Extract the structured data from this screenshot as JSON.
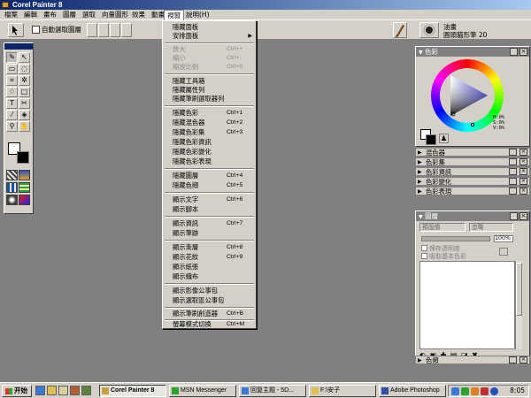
{
  "window": {
    "title": "Corel Painter 8"
  },
  "menubar": {
    "items": [
      {
        "label": "檔案"
      },
      {
        "label": "編輯"
      },
      {
        "label": "畫布"
      },
      {
        "label": "圖層"
      },
      {
        "label": "選取"
      },
      {
        "label": "向量圖形"
      },
      {
        "label": "效果"
      },
      {
        "label": "動畫"
      },
      {
        "label": "視窗"
      },
      {
        "label": "說明(H)"
      }
    ],
    "active_index": 8
  },
  "propbar": {
    "auto_select_layer_label": "自動選取圖層",
    "brush_category": "油畫",
    "brush_variant": "圓頭貓形筆 20"
  },
  "window_menu": {
    "items": [
      {
        "label": "隱藏面板",
        "shortcut": ""
      },
      {
        "label": "安排面板",
        "shortcut": "",
        "submenu": true
      },
      {
        "label": "放大",
        "shortcut": "Ctrl++",
        "disabled": true
      },
      {
        "label": "縮小",
        "shortcut": "Ctrl+-",
        "disabled": true
      },
      {
        "label": "縮放比例",
        "shortcut": "Ctrl+0",
        "disabled": true
      },
      {
        "label": "隱藏工具箱",
        "shortcut": ""
      },
      {
        "label": "隱藏屬性列",
        "shortcut": ""
      },
      {
        "label": "隱藏筆刷選取器列",
        "shortcut": ""
      },
      {
        "label": "隱藏色彩",
        "shortcut": "Ctrl+1"
      },
      {
        "label": "隱藏混色器",
        "shortcut": "Ctrl+2"
      },
      {
        "label": "隱藏色彩集",
        "shortcut": "Ctrl+3"
      },
      {
        "label": "隱藏色彩資訊",
        "shortcut": ""
      },
      {
        "label": "隱藏色彩變化",
        "shortcut": ""
      },
      {
        "label": "隱藏色彩表現",
        "shortcut": ""
      },
      {
        "label": "隱藏圖層",
        "shortcut": "Ctrl+4"
      },
      {
        "label": "隱藏色頻",
        "shortcut": "Ctrl+5"
      },
      {
        "label": "顯示文字",
        "shortcut": "Ctrl+6"
      },
      {
        "label": "顯示腳本",
        "shortcut": ""
      },
      {
        "label": "顯示資訊",
        "shortcut": "Ctrl+7"
      },
      {
        "label": "顯示筆跡",
        "shortcut": ""
      },
      {
        "label": "顯示漸層",
        "shortcut": "Ctrl+8"
      },
      {
        "label": "顯示花紋",
        "shortcut": "Ctrl+9"
      },
      {
        "label": "顯示紙張",
        "shortcut": ""
      },
      {
        "label": "顯示織布",
        "shortcut": ""
      },
      {
        "label": "顯示影像公事包",
        "shortcut": ""
      },
      {
        "label": "顯示選取區公事包",
        "shortcut": ""
      },
      {
        "label": "顯示筆刷創造器",
        "shortcut": "Ctrl+B"
      },
      {
        "label": "螢幕模式切換",
        "shortcut": "Ctrl+M"
      }
    ]
  },
  "color_panel": {
    "title": "色彩",
    "readout": {
      "h": "H:0%",
      "s": "S:0%",
      "v": "V:0%"
    },
    "accent": "#2020d0"
  },
  "collapsed_panels": [
    {
      "label": "混色器"
    },
    {
      "label": "色彩集"
    },
    {
      "label": "色彩資訊"
    },
    {
      "label": "色彩變化"
    },
    {
      "label": "色彩表現"
    }
  ],
  "layers_panel": {
    "title": "圖層",
    "composite_method": "預設值",
    "composite_depth": "忽略",
    "opacity": "100%",
    "preserve_transparency": "保存透明度",
    "pick_up_underlying": "吸取基本色彩"
  },
  "channels_panel": {
    "title": "色頻"
  },
  "taskbar": {
    "start_label": "开始",
    "tasks": [
      {
        "label": "Corel Painter 8",
        "active": true
      },
      {
        "label": "MSN Messenger",
        "active": false
      },
      {
        "label": "回复主题 - 5D...",
        "active": false
      },
      {
        "label": "F:\\安子",
        "active": false
      },
      {
        "label": "Adobe Photoshop",
        "active": false
      }
    ],
    "clock": "8:05"
  }
}
